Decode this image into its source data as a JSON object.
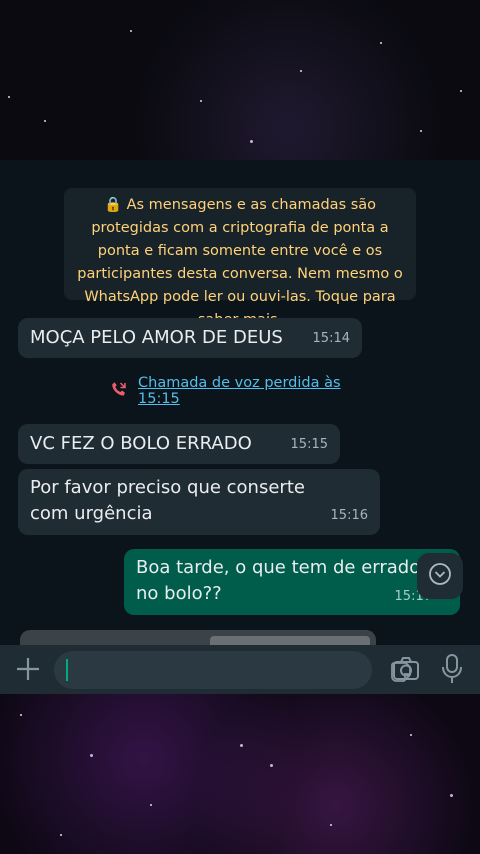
{
  "encryption_notice": "🔒 As mensagens e as chamadas são protegidas com a criptografia de ponta a ponta e ficam somente entre você e os participantes desta conversa. Nem mesmo o WhatsApp pode ler ou ouvi-las. Toque para saber mais.",
  "messages": [
    {
      "direction": "incoming",
      "text": "MOÇA PELO AMOR DE DEUS",
      "time": "15:14"
    },
    {
      "direction": "incoming",
      "text": "VC FEZ O BOLO ERRADO",
      "time": "15:15"
    },
    {
      "direction": "incoming",
      "text": "Por favor preciso que conserte com urgência",
      "time": "15:16"
    },
    {
      "direction": "outgoing",
      "text": "Boa tarde, o que tem de errado no bolo??",
      "time": "15:17"
    }
  ],
  "missed_call": {
    "text": "Chamada de voz perdida às 15:15"
  },
  "input": {
    "placeholder": ""
  },
  "icons": {
    "missed_call": "missed-call-icon",
    "scroll_down": "chevron-down-icon",
    "attach": "plus-icon",
    "sticker": "sticker-icon",
    "camera": "camera-icon",
    "mic": "mic-icon"
  },
  "colors": {
    "accent": "#53bdeb",
    "outgoing_bubble": "#005c4b",
    "incoming_bubble": "#202c33",
    "notice_text": "#ffd279",
    "missed_call_icon": "#f15c6d"
  }
}
